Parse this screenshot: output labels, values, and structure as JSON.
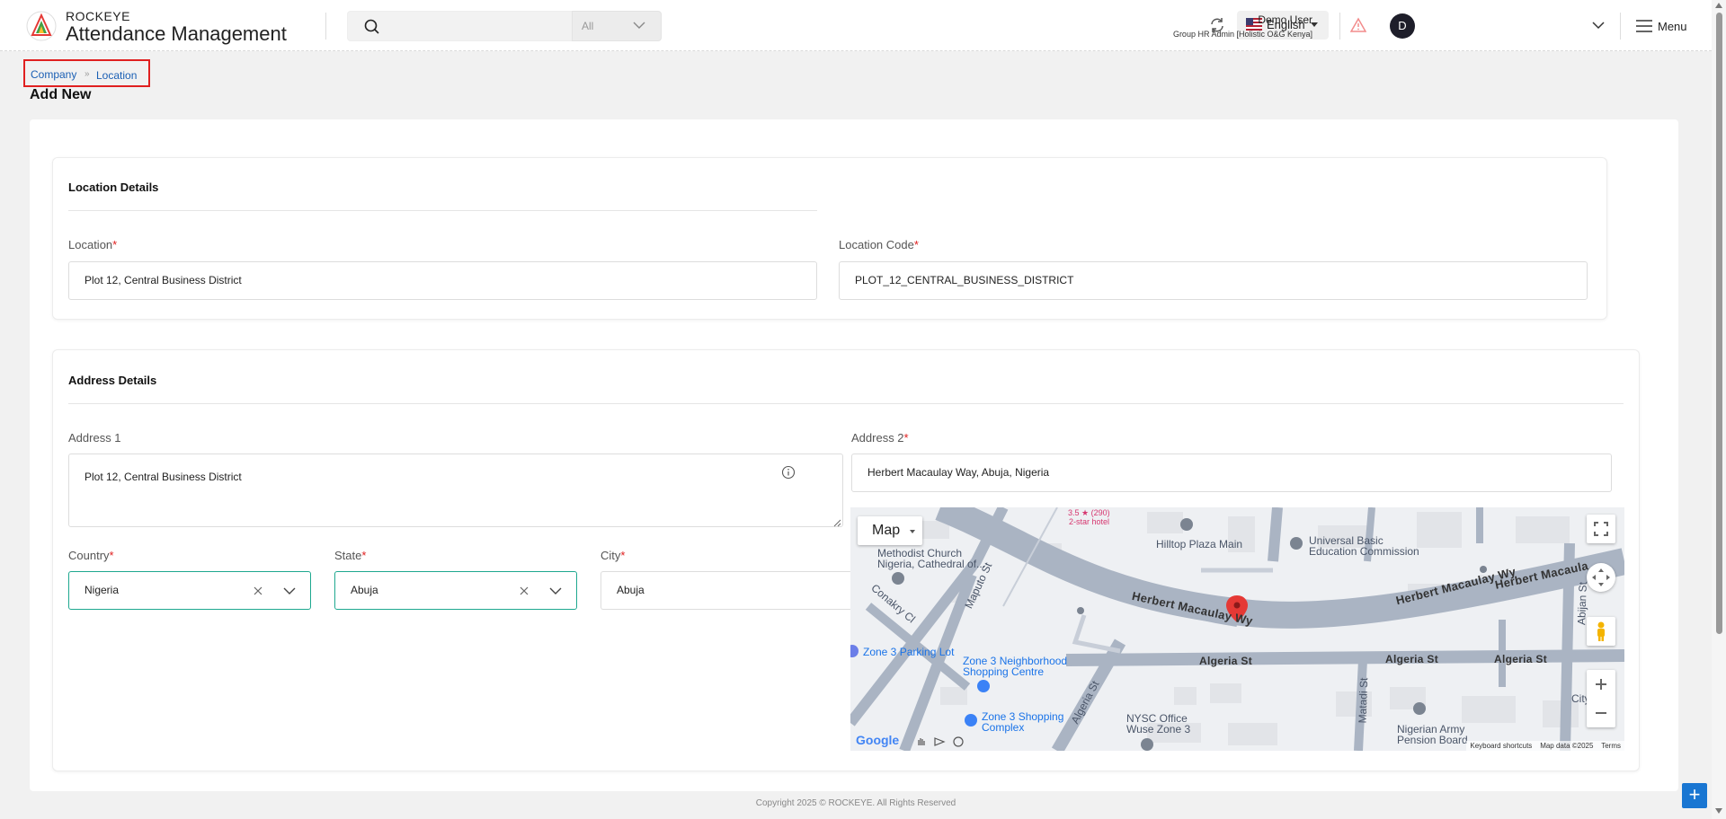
{
  "header": {
    "brand_top": "ROCKEYE",
    "brand_main": "Attendance Management",
    "search_placeholder": "",
    "search_scope": "All",
    "language": "English",
    "avatar_initial": "D",
    "user_name": "Demo User",
    "user_role": "Group HR Admin [Holistic O&G Kenya]",
    "menu_label": "Menu"
  },
  "breadcrumb": {
    "company": "Company",
    "location": "Location"
  },
  "page_title": "Add New",
  "location_details": {
    "title": "Location Details",
    "location_label": "Location",
    "location_value": "Plot 12, Central Business District",
    "code_label": "Location Code",
    "code_value": "PLOT_12_CENTRAL_BUSINESS_DISTRICT"
  },
  "address_details": {
    "title": "Address Details",
    "address1_label": "Address 1",
    "address1_value": "Plot 12, Central Business District",
    "address2_label": "Address 2",
    "address2_value": "Herbert Macaulay Way, Abuja, Nigeria",
    "country_label": "Country",
    "country_value": "Nigeria",
    "state_label": "State",
    "state_value": "Abuja",
    "city_label": "City",
    "city_value": "Abuja"
  },
  "map": {
    "type_label": "Map",
    "labels": {
      "hotel_rating": "3.5 ★ (290)",
      "hotel_class": "2-star hotel",
      "hilltop": "Hilltop Plaza Main",
      "ube1": "Universal Basic",
      "ube2": "Education Commission",
      "methodist1": "Methodist Church",
      "methodist2": "Nigeria, Cathedral of...",
      "conakry": "Conakry Cl",
      "maputo": "Maputo St",
      "herbert1": "Herbert Macaulay Wy",
      "herbert2": "Herbert Macaulay Wy",
      "herbert3": "Herbert Macaula",
      "abijan": "Abijan St",
      "parking": "Zone 3 Parking Lot",
      "neigh1": "Zone 3 Neighborhood",
      "neigh2": "Shopping Centre",
      "algeria1": "Algeria St",
      "algeria2": "Algeria St",
      "algeria3": "Algeria St",
      "algeria4": "Algeria St",
      "matadi": "Matadi St",
      "zone3shop1": "Zone 3 Shopping",
      "zone3shop2": "Complex",
      "nysc1": "NYSC Office",
      "nysc2": "Wuse Zone 3",
      "army1": "Nigerian Army",
      "army2": "Pension Board",
      "city_partial": "City"
    },
    "footer_shortcuts": "Keyboard shortcuts",
    "footer_data": "Map data ©2025",
    "footer_terms": "Terms",
    "google": "Google"
  },
  "footer": {
    "copyright": "Copyright 2025 © ROCKEYE. All Rights Reserved"
  },
  "colors": {
    "accent": "#1ea88f",
    "link": "#1a5fb4",
    "required": "#e02020",
    "fab": "#1976d2"
  }
}
